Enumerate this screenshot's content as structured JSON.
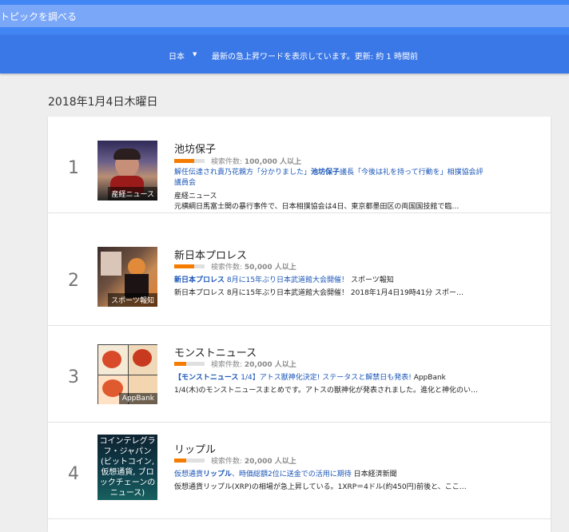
{
  "header": {
    "search_placeholder": "トピックを調べる",
    "country": "日本",
    "notice": "最新の急上昇ワードを表示しています。更新: 約 1 時間前"
  },
  "date": "2018年1月4日木曜日",
  "items": [
    {
      "rank": "1",
      "title": "池坊保子",
      "count_prefix": "検索件数: ",
      "count": "100,000 人以上",
      "popularity": 0.66,
      "headline_pre": "解任伝達され貴乃花親方「分かりました」",
      "headline_bold": "池坊保子",
      "headline_post": "議長「今後は礼を持って行動を」相撲協会評議員会",
      "source": "産経ニュース",
      "snippet": "元横綱日馬富士関の暴行事件で、日本相撲協会は4日、東京都墨田区の両国国技館で臨…",
      "thumb_source": "産経ニュース",
      "thumb_colors": [
        "#4a3a6e",
        "#c7a07e"
      ]
    },
    {
      "rank": "2",
      "title": "新日本プロレス",
      "count_prefix": "検索件数: ",
      "count": "50,000 人以上",
      "popularity": 0.66,
      "headline_bold": "新日本プロレス",
      "headline_post": " 8月に15年ぶり日本武道館大会開催！",
      "headline_source": "スポーツ報知",
      "snippet": "新日本プロレス 8月に15年ぶり日本武道館大会開催！ 2018年1月4日19時41分 スポー…",
      "thumb_source": "スポーツ報知",
      "thumb_colors": [
        "#6b4a3a",
        "#d9772f"
      ]
    },
    {
      "rank": "3",
      "title": "モンストニュース",
      "count_prefix": "検索件数: ",
      "count": "20,000 人以上",
      "popularity": 0.4,
      "headline_bold": "【モンストニュース",
      "headline_post": " 1/4】アトス獣神化決定! ステータスと解禁日も発表!",
      "headline_source": "AppBank",
      "snippet": "1/4(木)のモンストニュースまとめです。アトスの獣神化が発表されました。進化と神化のい…",
      "thumb_source": "AppBank",
      "thumb_colors": [
        "#e3d7c0",
        "#c84a2f"
      ]
    },
    {
      "rank": "4",
      "title": "リップル",
      "count_prefix": "検索件数: ",
      "count": "20,000 人以上",
      "popularity": 0.4,
      "headline_pre": "仮想通貨",
      "headline_bold": "リップル",
      "headline_post": "、時価総額2位に送金での活用に期待",
      "headline_source": "日本経済新聞",
      "snippet": "仮想通貨リップル(XRP)の相場が急上昇している。1XRP＝4ドル(約450円)前後と、ここ…",
      "thumb_text": "コインテレグラフ・ジャパン(ビットコイン, 仮想通貨, ブロックチェーンのニュース)",
      "thumb_colors": [
        "#0c2a3a",
        "#135a5a"
      ]
    }
  ]
}
